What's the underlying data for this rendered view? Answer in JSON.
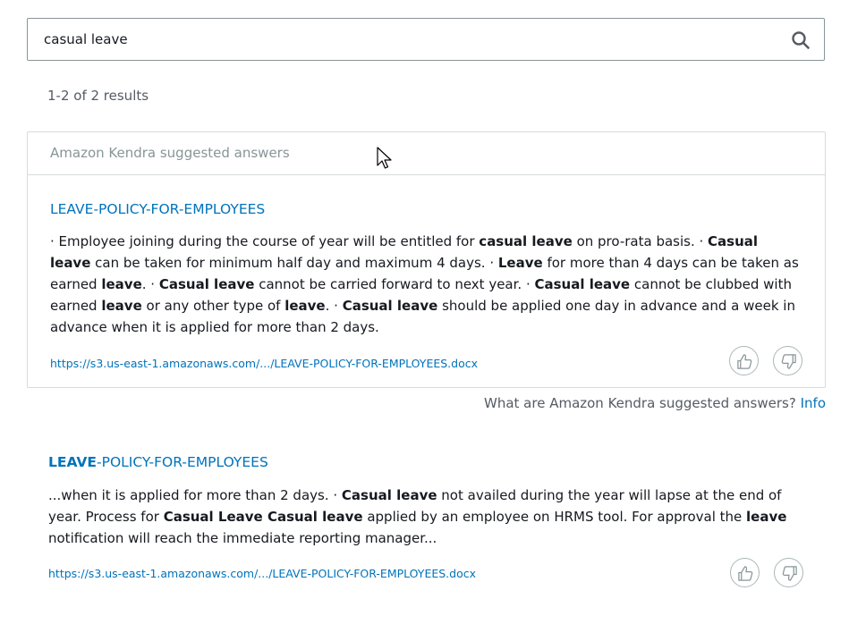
{
  "search": {
    "query": "casual leave",
    "icon": "search-icon"
  },
  "results_summary": "1-2 of 2 results",
  "suggested": {
    "header": "Amazon Kendra suggested answers",
    "title": "LEAVE-POLICY-FOR-EMPLOYEES",
    "excerpt": [
      {
        "t": "· Employee joining during the course of year will be entitled for ",
        "b": false
      },
      {
        "t": "casual leave",
        "b": true
      },
      {
        "t": " on pro-rata basis. · ",
        "b": false
      },
      {
        "t": "Casual leave",
        "b": true
      },
      {
        "t": " can be taken for minimum half day and maximum 4 days. · ",
        "b": false
      },
      {
        "t": "Leave",
        "b": true
      },
      {
        "t": " for more than 4 days can be taken as earned ",
        "b": false
      },
      {
        "t": "leave",
        "b": true
      },
      {
        "t": ". · ",
        "b": false
      },
      {
        "t": "Casual leave",
        "b": true
      },
      {
        "t": " cannot be carried forward to next year. · ",
        "b": false
      },
      {
        "t": "Casual leave",
        "b": true
      },
      {
        "t": " cannot be clubbed with earned ",
        "b": false
      },
      {
        "t": "leave",
        "b": true
      },
      {
        "t": " or any other type of ",
        "b": false
      },
      {
        "t": "leave",
        "b": true
      },
      {
        "t": ". · ",
        "b": false
      },
      {
        "t": "Casual leave",
        "b": true
      },
      {
        "t": " should be applied one day in advance and a week in advance when it is applied for more than 2 days.",
        "b": false
      }
    ],
    "url": "https://s3.us-east-1.amazonaws.com/.../LEAVE-POLICY-FOR-EMPLOYEES.docx",
    "thumbs_up_icon": "thumbs-up-icon",
    "thumbs_down_icon": "thumbs-down-icon"
  },
  "info_line": {
    "text": "What are Amazon Kendra suggested answers?",
    "link": "Info"
  },
  "result": {
    "title_bold": "LEAVE",
    "title_rest": "-POLICY-FOR-EMPLOYEES",
    "excerpt": [
      {
        "t": "...when it is applied for more than 2 days. · ",
        "b": false
      },
      {
        "t": "Casual leave",
        "b": true
      },
      {
        "t": " not availed during the year will lapse at the end of year. Process for ",
        "b": false
      },
      {
        "t": "Casual Leave Casual leave",
        "b": true
      },
      {
        "t": " applied by an employee on HRMS tool. For approval the ",
        "b": false
      },
      {
        "t": "leave",
        "b": true
      },
      {
        "t": " notification will reach the immediate reporting manager...",
        "b": false
      }
    ],
    "url": "https://s3.us-east-1.amazonaws.com/.../LEAVE-POLICY-FOR-EMPLOYEES.docx"
  },
  "colors": {
    "link": "#0073bb",
    "border": "#d5dbdb",
    "muted": "#879596",
    "text": "#16191f"
  }
}
